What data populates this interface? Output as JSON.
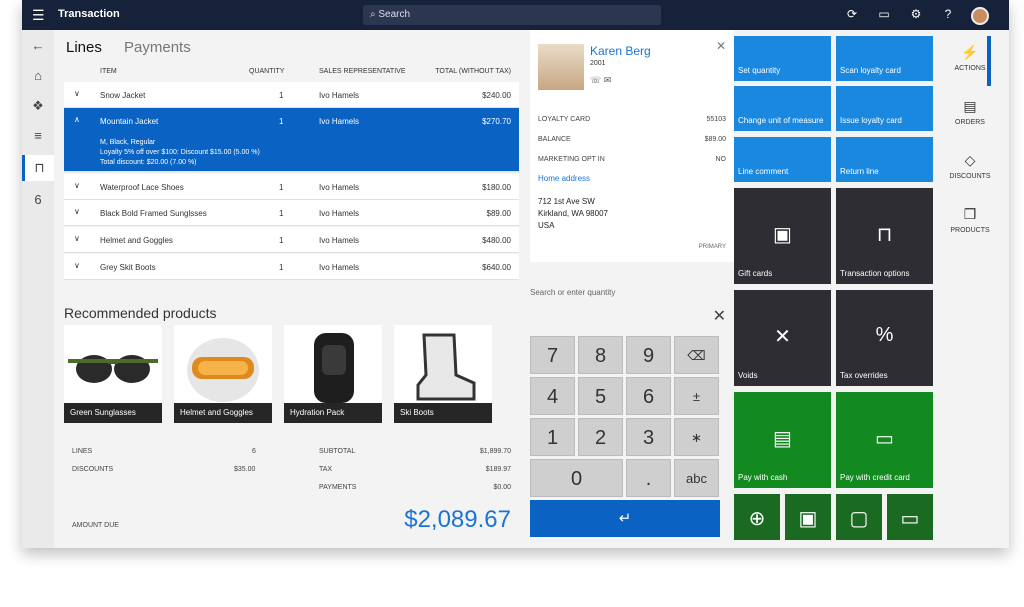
{
  "header": {
    "title": "Transaction",
    "search_placeholder": "Search"
  },
  "tabs": [
    "Lines",
    "Payments"
  ],
  "columns": [
    "ITEM",
    "QUANTITY",
    "SALES REPRESENTATIVE",
    "TOTAL (WITHOUT TAX)"
  ],
  "lines": [
    {
      "item": "Snow Jacket",
      "qty": "1",
      "rep": "Ivo Hamels",
      "total": "$240.00"
    },
    {
      "item": "Mountain Jacket",
      "qty": "1",
      "rep": "Ivo Hamels",
      "total": "$270.70",
      "details": [
        "M, Black, Regular",
        "Loyalty 5% off over $100: Discount $15.00 (5.00 %)",
        "Total discount: $20.00 (7.00 %)"
      ]
    },
    {
      "item": "Waterproof Lace Shoes",
      "qty": "1",
      "rep": "Ivo Hamels",
      "total": "$180.00"
    },
    {
      "item": "Black Bold Framed Sunglsses",
      "qty": "1",
      "rep": "Ivo Hamels",
      "total": "$89.00"
    },
    {
      "item": "Helmet and Goggles",
      "qty": "1",
      "rep": "Ivo Hamels",
      "total": "$480.00"
    },
    {
      "item": "Grey Skit Boots",
      "qty": "1",
      "rep": "Ivo Hamels",
      "total": "$640.00"
    }
  ],
  "recommended": {
    "title": "Recommended products",
    "items": [
      "Green Sunglasses",
      "Helmet and Goggles",
      "Hydration Pack",
      "Ski Boots"
    ]
  },
  "summary": {
    "lines_label": "LINES",
    "lines": "6",
    "discounts_label": "DISCOUNTS",
    "discounts": "$35.00",
    "subtotal_label": "SUBTOTAL",
    "subtotal": "$1,899.70",
    "tax_label": "TAX",
    "tax": "$189.97",
    "payments_label": "PAYMENTS",
    "payments": "$0.00",
    "amount_due_label": "AMOUNT DUE",
    "amount_due": "$2,089.67"
  },
  "customer": {
    "name": "Karen Berg",
    "id": "2001",
    "loyalty_label": "LOYALTY CARD",
    "loyalty": "55103",
    "balance_label": "BALANCE",
    "balance": "$89.00",
    "opt_label": "MARKETING OPT IN",
    "opt": "NO",
    "home_address": "Home address",
    "address": [
      "712 1st Ave SW",
      "Kirkland, WA 98007",
      "USA"
    ],
    "primary": "PRIMARY"
  },
  "numpad": {
    "placeholder": "Search or enter quantity",
    "keys": [
      "7",
      "8",
      "9",
      "⌫",
      "4",
      "5",
      "6",
      "±",
      "1",
      "2",
      "3",
      "∗",
      "0",
      ".",
      "abc"
    ],
    "enter": "↵"
  },
  "tiles": {
    "set_quantity": "Set quantity",
    "scan_loyalty": "Scan loyalty card",
    "change_unit": "Change unit of measure",
    "issue_loyalty": "Issue loyalty card",
    "line_comment": "Line comment",
    "return_line": "Return line",
    "gift_cards": "Gift cards",
    "transaction_options": "Transaction options",
    "voids": "Voids",
    "tax_overrides": "Tax overrides",
    "pay_cash": "Pay with cash",
    "pay_credit": "Pay with credit card"
  },
  "rail": [
    "ACTIONS",
    "ORDERS",
    "DISCOUNTS",
    "PRODUCTS"
  ],
  "nav_count": "6"
}
